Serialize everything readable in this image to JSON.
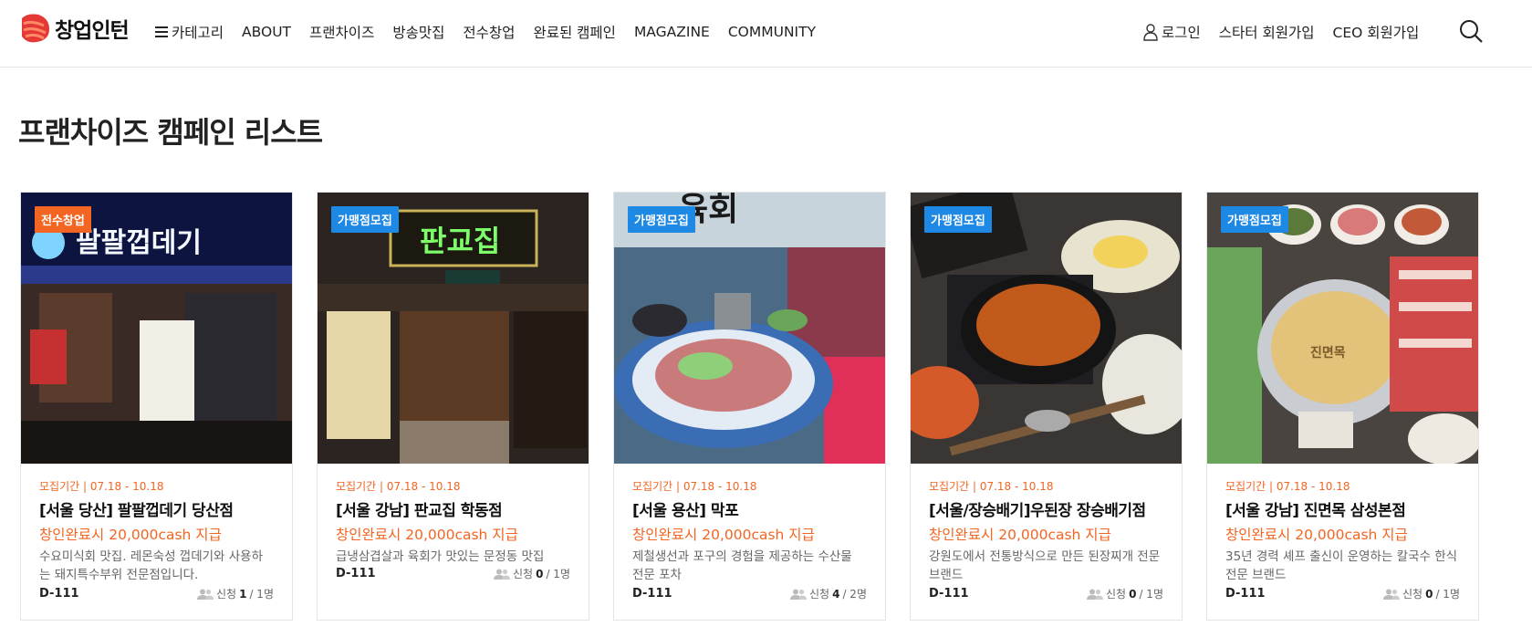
{
  "header": {
    "logo_text": "창업인턴",
    "nav": [
      {
        "label": "카테고리",
        "icon": "hamburger-icon"
      },
      {
        "label": "ABOUT"
      },
      {
        "label": "프랜차이즈"
      },
      {
        "label": "방송맛집"
      },
      {
        "label": "전수창업"
      },
      {
        "label": "완료된 캠페인"
      },
      {
        "label": "MAGAZINE"
      },
      {
        "label": "COMMUNITY"
      }
    ],
    "auth": [
      {
        "label": "로그인",
        "icon": "user-icon"
      },
      {
        "label": "스타터 회원가입"
      },
      {
        "label": "CEO 회원가입"
      }
    ],
    "search_icon": "search-icon"
  },
  "page_title": "프랜차이즈 캠페인 리스트",
  "colors": {
    "accent": "#f26522",
    "badge_blue": "#1e88e5"
  },
  "cards": [
    {
      "badge": "전수창업",
      "period": "모집기간 | 07.18 - 10.18",
      "title": "[서울 당산] 팔팔껍데기 당산점",
      "reward": "창인완료시 20,000cash 지급",
      "desc": "수요미식회 맛집. 레몬숙성 껍데기와 사용하는 돼지특수부위 전문점입니다.",
      "dday": "D-111",
      "apply_label": "신청",
      "applied": "1",
      "capacity": "/ 1명",
      "image_caption": "팔팔껍데기"
    },
    {
      "badge": "가맹점모집",
      "period": "모집기간 | 07.18 - 10.18",
      "title": "[서울 강남] 판교집 학동점",
      "reward": "창인완료시 20,000cash 지급",
      "desc": "급냉삼겹살과 육회가 맛있는 문정동 맛집",
      "dday": "D-111",
      "apply_label": "신청",
      "applied": "0",
      "capacity": "/ 1명",
      "image_caption": "판교집"
    },
    {
      "badge": "가맹점모집",
      "period": "모집기간 | 07.18 - 10.18",
      "title": "[서울 용산] 막포",
      "reward": "창인완료시 20,000cash 지급",
      "desc": "제철생선과 포구의 경험을 제공하는 수산물 전문 포차",
      "dday": "D-111",
      "apply_label": "신청",
      "applied": "4",
      "capacity": "/ 2명",
      "image_caption": "육회"
    },
    {
      "badge": "가맹점모집",
      "period": "모집기간 | 07.18 - 10.18",
      "title": "[서울/장승배기]우된장 장승배기점",
      "reward": "창인완료시 20,000cash 지급",
      "desc": "강원도에서 전통방식으로 만든 된장찌개 전문 브랜드",
      "dday": "D-111",
      "apply_label": "신청",
      "applied": "0",
      "capacity": "/ 1명",
      "image_caption": ""
    },
    {
      "badge": "가맹점모집",
      "period": "모집기간 | 07.18 - 10.18",
      "title": "[서울 강남] 진면목 삼성본점",
      "reward": "창인완료시 20,000cash 지급",
      "desc": "35년 경력 셰프 출신이 운영하는 칼국수 한식 전문 브랜드",
      "dday": "D-111",
      "apply_label": "신청",
      "applied": "0",
      "capacity": "/ 1명",
      "image_caption": "진면목"
    }
  ]
}
